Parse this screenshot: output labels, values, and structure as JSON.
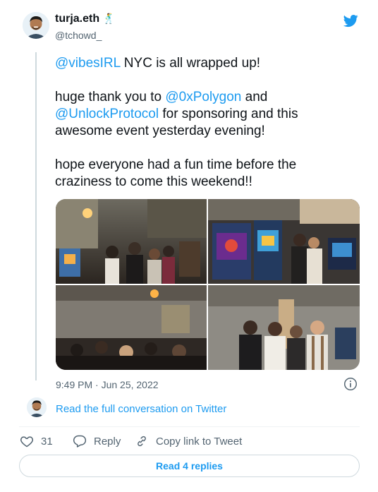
{
  "author": {
    "name": "turja.eth",
    "handle": "@tchowd_",
    "name_emoji": "🕺"
  },
  "tweet": {
    "mention1": "@vibesIRL",
    "line1_rest": " NYC is all wrapped up!",
    "line2_pre": "huge thank you to ",
    "mention2": "@0xPolygon",
    "line2_and": " and ",
    "mention3": "@UnlockProtocol",
    "line2_rest": " for sponsoring and this awesome event yesterday evening!",
    "line3": "hope everyone had a fun time before the craziness to come this weekend!!"
  },
  "timestamp": "9:49 PM · Jun 25, 2022",
  "read_convo": "Read the full conversation on Twitter",
  "actions": {
    "like_count": "31",
    "reply_label": "Reply",
    "copy_label": "Copy link to Tweet"
  },
  "replies_button": "Read 4 replies",
  "colors": {
    "accent": "#1d9bf0",
    "text": "#0f1419",
    "muted": "#536471"
  },
  "icons": [
    "twitter-bird-icon",
    "info-icon",
    "heart-icon",
    "reply-icon",
    "link-icon"
  ]
}
